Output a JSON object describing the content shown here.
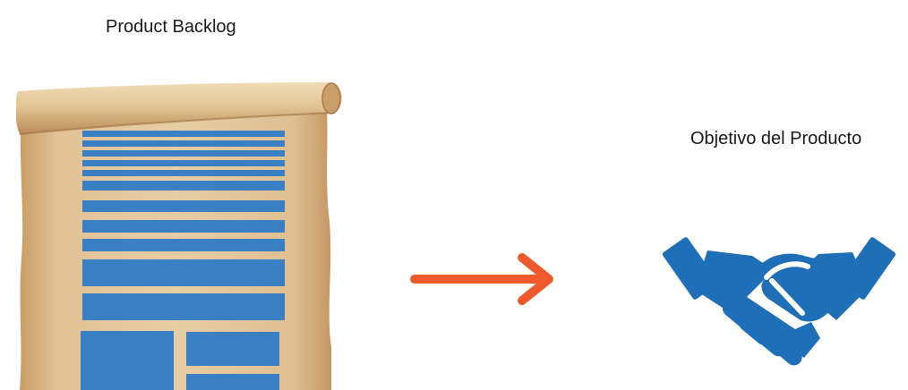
{
  "backlog": {
    "title": "Product Backlog"
  },
  "goal": {
    "title": "Objetivo del Producto"
  },
  "colors": {
    "item_blue": "#3a7fc4",
    "arrow_orange": "#ee5a2c",
    "handshake_blue": "#1f6fb8",
    "parchment": "#d9b88a"
  },
  "icons": {
    "scroll": "scroll-icon",
    "arrow": "arrow-right-icon",
    "handshake": "handshake-icon"
  }
}
